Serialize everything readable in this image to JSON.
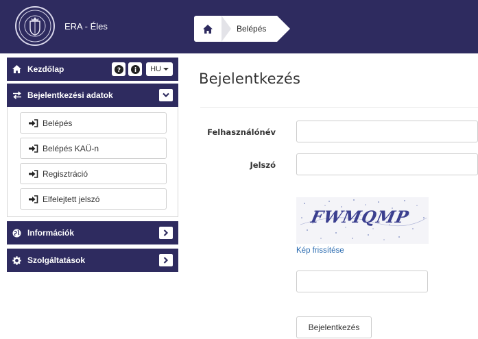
{
  "app": {
    "title": "ERA - Éles"
  },
  "breadcrumb": {
    "current": "Belépés"
  },
  "sidebar": {
    "home_label": "Kezdőlap",
    "language": "HU",
    "login_panel": {
      "title": "Bejelentkezési adatok",
      "items": [
        {
          "label": "Belépés"
        },
        {
          "label": "Belépés KAÜ-n"
        },
        {
          "label": "Regisztráció"
        },
        {
          "label": "Elfelejtett jelszó"
        }
      ]
    },
    "info_label": "Információk",
    "services_label": "Szolgáltatások"
  },
  "main": {
    "title": "Bejelentkezés",
    "username_label": "Felhasználónév",
    "password_label": "Jelszó",
    "username_value": "",
    "password_value": "",
    "captcha_text": "FWMQMP",
    "captcha_refresh": "Kép frissítése",
    "captcha_value": "",
    "submit_label": "Bejelentkezés"
  },
  "colors": {
    "header_bg": "#2e2b5f",
    "link": "#2a6bb0"
  }
}
